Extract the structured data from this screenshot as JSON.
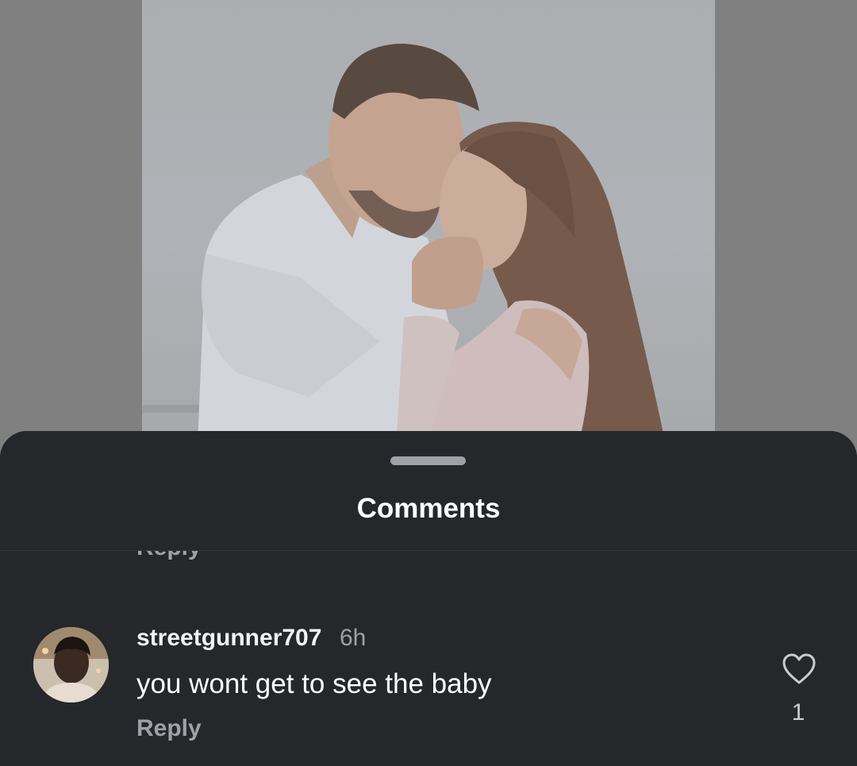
{
  "post": {
    "image_alt": "couple photo"
  },
  "sheet": {
    "title": "Comments"
  },
  "comments": {
    "previous_reply_label": "Reply",
    "items": [
      {
        "username": "streetgunner707",
        "time": "6h",
        "text": "you wont get to see the baby",
        "reply_label": "Reply",
        "like_count": "1",
        "like_icon": "heart-outline-icon"
      }
    ]
  },
  "colors": {
    "sheet_bg": "#25272b",
    "muted_text": "#9ea2a8",
    "primary_text": "#ffffff"
  }
}
